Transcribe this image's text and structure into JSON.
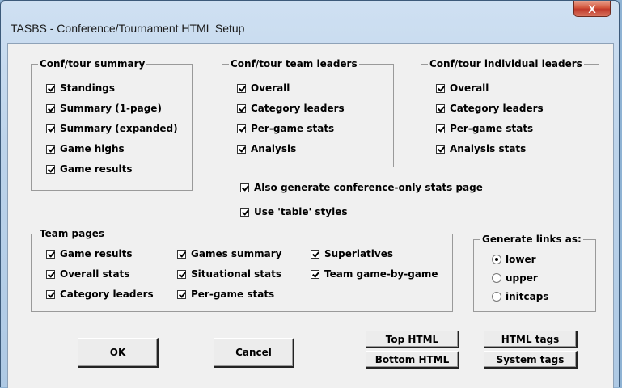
{
  "window": {
    "title": "TASBS - Conference/Tournament HTML Setup",
    "close_glyph": "X"
  },
  "conf_summary": {
    "title": "Conf/tour summary",
    "items": [
      {
        "label": "Standings",
        "checked": true
      },
      {
        "label": "Summary (1-page)",
        "checked": true
      },
      {
        "label": "Summary (expanded)",
        "checked": true
      },
      {
        "label": "Game highs",
        "checked": true
      },
      {
        "label": "Game results",
        "checked": true
      }
    ]
  },
  "team_leaders": {
    "title": "Conf/tour team leaders",
    "items": [
      {
        "label": "Overall",
        "checked": true
      },
      {
        "label": "Category leaders",
        "checked": true
      },
      {
        "label": "Per-game stats",
        "checked": true
      },
      {
        "label": "Analysis",
        "checked": true
      }
    ]
  },
  "individual_leaders": {
    "title": "Conf/tour individual leaders",
    "items": [
      {
        "label": "Overall",
        "checked": true
      },
      {
        "label": "Category leaders",
        "checked": true
      },
      {
        "label": "Per-game stats",
        "checked": true
      },
      {
        "label": "Analysis stats",
        "checked": true
      }
    ]
  },
  "options": {
    "conference_only": {
      "label": "Also generate conference-only stats page",
      "checked": true
    },
    "table_styles": {
      "label": "Use 'table' styles",
      "checked": true
    }
  },
  "team_pages": {
    "title": "Team pages",
    "items": [
      {
        "label": "Game results",
        "checked": true
      },
      {
        "label": "Overall stats",
        "checked": true
      },
      {
        "label": "Category leaders",
        "checked": true
      },
      {
        "label": "Games summary",
        "checked": true
      },
      {
        "label": "Situational stats",
        "checked": true
      },
      {
        "label": "Per-game stats",
        "checked": true
      },
      {
        "label": "Superlatives",
        "checked": true
      },
      {
        "label": "Team game-by-game",
        "checked": true
      }
    ]
  },
  "links": {
    "title": "Generate links as:",
    "options": [
      {
        "label": "lower",
        "selected": true
      },
      {
        "label": "upper",
        "selected": false
      },
      {
        "label": "initcaps",
        "selected": false
      }
    ]
  },
  "buttons": {
    "ok": "OK",
    "cancel": "Cancel",
    "top_html": "Top HTML",
    "bottom_html": "Bottom HTML",
    "html_tags": "HTML tags",
    "system_tags": "System tags"
  },
  "colors": {
    "title_bar": "#bcd3ea",
    "close_button": "#c0392b",
    "dialog_background": "#f0f0f0"
  }
}
